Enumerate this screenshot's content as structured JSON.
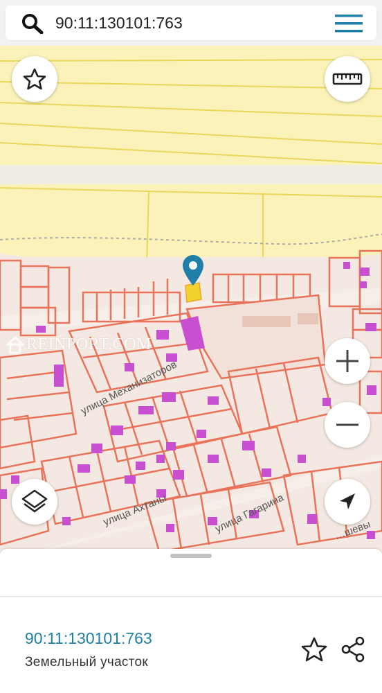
{
  "search": {
    "value": "90:11:130101:763",
    "icon": "search-icon",
    "menu_icon": "hamburger-menu-icon"
  },
  "map": {
    "watermark": "REINPORT.COM",
    "streets": [
      {
        "label": "улица Механизаторов"
      },
      {
        "label": "улица Ахтаны"
      },
      {
        "label": "улица Гагарина"
      },
      {
        "label": "…шевы"
      }
    ],
    "marker": "map-pin-icon",
    "colors": {
      "agricultural": "#faf2b8",
      "parcel_border": "#e8735a",
      "building": "#c84fd0",
      "road": "#f2ede8",
      "marker": "#1f7fa8",
      "selected_parcel": "#f2d22c"
    }
  },
  "controls": {
    "favorite": "star-outline-icon",
    "ruler": "ruler-icon",
    "zoom_in": "plus-icon",
    "zoom_out": "minus-icon",
    "layers": "layers-icon",
    "locate": "navigation-arrow-icon"
  },
  "sheet": {
    "parcel_id": "90:11:130101:763",
    "parcel_type": "Земельный участок",
    "star_icon": "star-outline-icon",
    "share_icon": "share-icon"
  }
}
